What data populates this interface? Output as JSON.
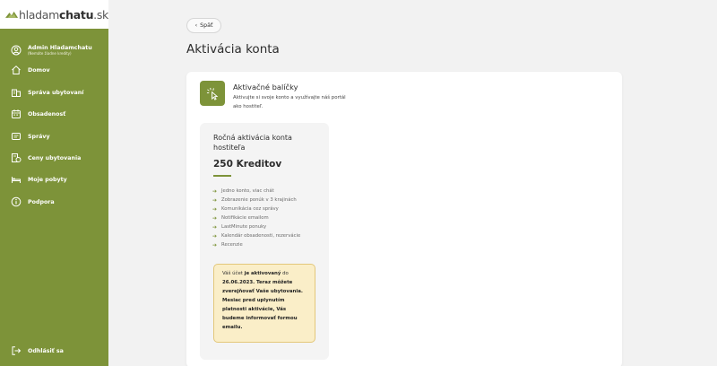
{
  "brand": {
    "name_regular": "hladam",
    "name_bold": "chatu",
    "name_tld": ".sk"
  },
  "user": {
    "name": "Admin Hladamchatu",
    "subtitle": "(Nemáte žiadne kredity)"
  },
  "sidebar": {
    "items": [
      {
        "label": "Domov",
        "icon": "home-icon"
      },
      {
        "label": "Správa ubytovaní",
        "icon": "building-icon"
      },
      {
        "label": "Obsadenosť",
        "icon": "calendar-icon"
      },
      {
        "label": "Správy",
        "icon": "message-icon"
      },
      {
        "label": "Ceny ubytovania",
        "icon": "price-icon"
      },
      {
        "label": "Moje pobyty",
        "icon": "bed-icon"
      },
      {
        "label": "Podpora",
        "icon": "info-icon"
      }
    ],
    "logout": {
      "label": "Odhlásiť sa",
      "icon": "logout-icon"
    }
  },
  "header": {
    "back_label": "Späť",
    "title": "Aktivácia konta"
  },
  "packages": {
    "title": "Aktivačné balíčky",
    "description": "Aktivujte si svoje konto a využívajte náš portál ako hostiteľ."
  },
  "offer": {
    "title": "Ročná aktivácia konta hostiteľa",
    "price": "250 Kreditov",
    "features": [
      "Jedno konto, viac chát",
      "Zobrazenie ponúk v 3 krajinách",
      "Komunikácia cez správy",
      "Notifikácie emailom",
      "LastMinute ponuky",
      "Kalendár obsadenosti, rezervácie",
      "Recenzie"
    ]
  },
  "notice": {
    "prefix": "Váš účet ",
    "status": "je aktivovaný",
    "suffix": " do ",
    "details": "26.06.2023. Teraz môžete zverejňovať Vaše ubytovania. Mesiac pred uplynutím platnosti aktivácie, Vás budeme informovať formou emailu."
  },
  "colors": {
    "accent": "#7d9339",
    "notice_bg": "#faeec8",
    "notice_border": "#e3c77a"
  }
}
